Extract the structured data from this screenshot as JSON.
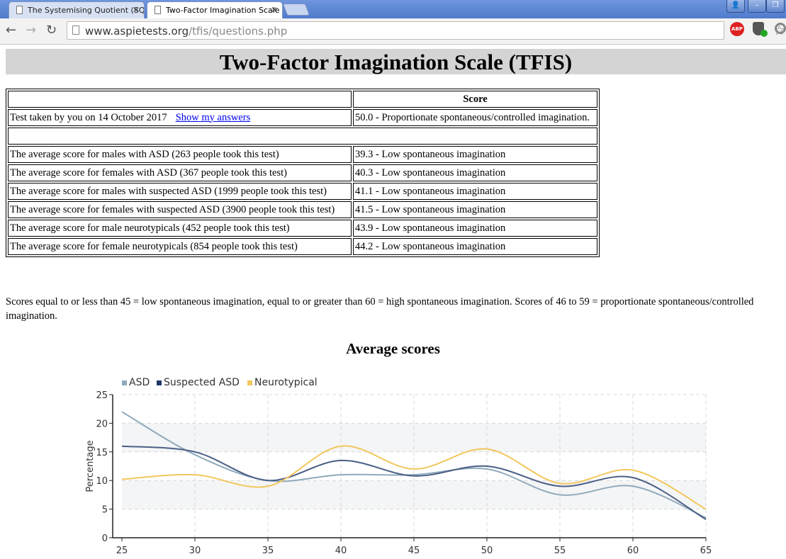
{
  "browser": {
    "tabs": [
      {
        "title": "The Systemising Quotient (SQ"
      },
      {
        "title": "Two-Factor Imagination Scale"
      }
    ],
    "url_domain": "www.aspietests.org",
    "url_path": "/tfis/questions.php",
    "abp_label": "ABP"
  },
  "page": {
    "title": "Two-Factor Imagination Scale (TFIS)",
    "table": {
      "header_score": "Score",
      "user_row": {
        "label": "Test taken by you on 14 October 2017",
        "link": "Show my answers",
        "score": "50.0 - Proportionate spontaneous/controlled imagination."
      },
      "rows": [
        {
          "label": "The average score for males with ASD (263 people took this test)",
          "score": "39.3 - Low spontaneous imagination"
        },
        {
          "label": "The average score for females with ASD (367 people took this test)",
          "score": "40.3 - Low spontaneous imagination"
        },
        {
          "label": "The average score for males with suspected ASD (1999 people took this test)",
          "score": "41.1 - Low spontaneous imagination"
        },
        {
          "label": "The average score for females with suspected ASD (3900 people took this test)",
          "score": "41.5 - Low spontaneous imagination"
        },
        {
          "label": "The average score for male neurotypicals (452 people took this test)",
          "score": "43.9 - Low spontaneous imagination"
        },
        {
          "label": "The average score for female neurotypicals (854 people took this test)",
          "score": "44.2 - Low spontaneous imagination"
        }
      ]
    },
    "note": "Scores equal to or less than 45 = low spontaneous imagination, equal to or greater than 60 = high spontaneous imagination. Scores of 46 to 59 = proportionate spontaneous/controlled imagination."
  },
  "chart_data": {
    "type": "line",
    "title": "Average scores",
    "ylabel": "Percentage",
    "xlabel": "",
    "ylim": [
      0,
      25
    ],
    "xlim": [
      25,
      65
    ],
    "x": [
      25,
      30,
      35,
      40,
      45,
      50,
      55,
      60,
      65
    ],
    "yticks": [
      0,
      5,
      10,
      15,
      20,
      25
    ],
    "legend_position": "top-left",
    "grid": true,
    "series": [
      {
        "name": "ASD",
        "color": "#8faabc",
        "values": [
          22,
          14.5,
          10,
          11,
          11,
          12,
          7.5,
          9,
          3.5
        ]
      },
      {
        "name": "Suspected ASD",
        "color": "#4b5f86",
        "values": [
          16,
          15,
          10,
          13.5,
          10.8,
          12.5,
          9,
          10.5,
          3.2
        ]
      },
      {
        "name": "Neurotypical",
        "color": "#f2c75c",
        "values": [
          10.2,
          11,
          9,
          16,
          12,
          15.5,
          9.5,
          11.8,
          5
        ]
      }
    ],
    "legend_marker_colors": [
      "#8faabc",
      "#1f3869",
      "#f2c75c"
    ]
  }
}
